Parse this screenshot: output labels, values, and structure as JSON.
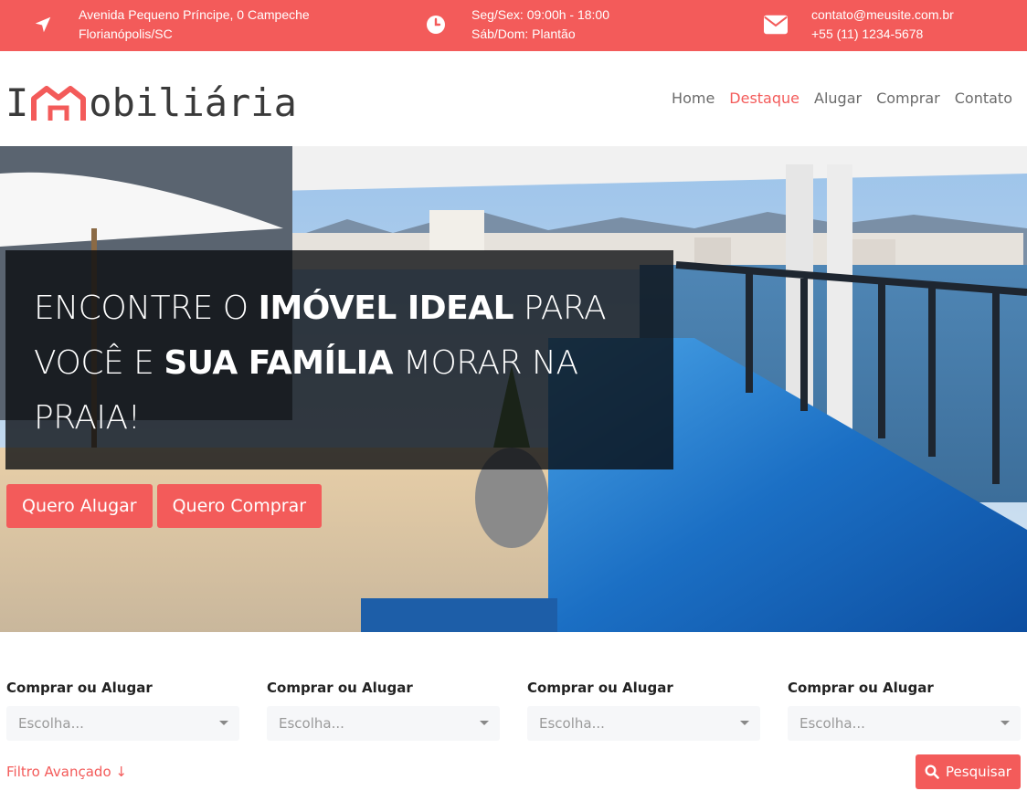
{
  "topbar": {
    "address_line1": "Avenida Pequeno Príncipe, 0 Campeche",
    "address_line2": "Florianópolis/SC",
    "hours_line1": "Seg/Sex: 09:00h - 18:00",
    "hours_line2": "Sáb/Dom: Plantão",
    "email": "contato@meusite.com.br",
    "phone": "+55 (11) 1234-5678",
    "icons": [
      "location-arrow-icon",
      "clock-icon",
      "envelope-icon"
    ]
  },
  "logo": {
    "prefix": "I",
    "suffix": "obiliária",
    "icon": "house-icon"
  },
  "nav": {
    "items": [
      {
        "label": "Home",
        "active": false
      },
      {
        "label": "Destaque",
        "active": true
      },
      {
        "label": "Alugar",
        "active": false
      },
      {
        "label": "Comprar",
        "active": false
      },
      {
        "label": "Contato",
        "active": false
      }
    ]
  },
  "hero": {
    "title_part1": "ENCONTRE O ",
    "title_bold1": "IMÓVEL IDEAL",
    "title_part2": " PARA VOCÊ E ",
    "title_bold2": "SUA FAMÍLIA",
    "title_part3": " MORAR NA PRAIA!",
    "btn_rent": "Quero Alugar",
    "btn_buy": "Quero Comprar"
  },
  "filters": {
    "fields": [
      {
        "label": "Comprar ou Alugar",
        "placeholder": "Escolha..."
      },
      {
        "label": "Comprar ou Alugar",
        "placeholder": "Escolha..."
      },
      {
        "label": "Comprar ou Alugar",
        "placeholder": "Escolha..."
      },
      {
        "label": "Comprar ou Alugar",
        "placeholder": "Escolha..."
      }
    ],
    "advanced_label": "Filtro Avançado ↓",
    "search_label": "Pesquisar"
  },
  "colors": {
    "accent": "#f35b5a",
    "text_dark": "#3a3a3a",
    "nav_text": "#6b6b6b"
  }
}
